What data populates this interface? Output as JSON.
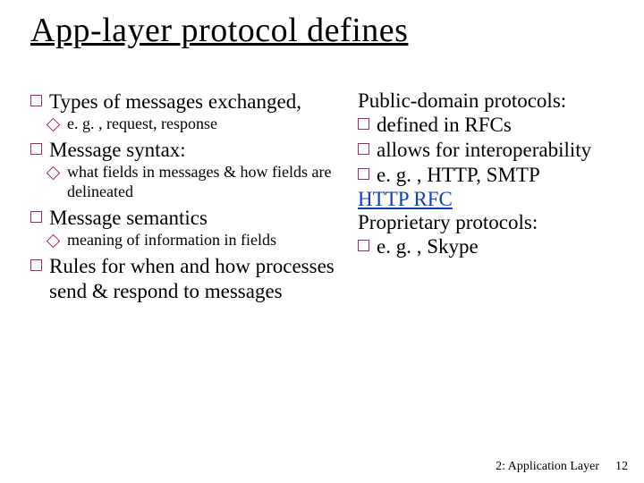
{
  "title": "App-layer protocol defines",
  "left": {
    "items": [
      {
        "text": "Types of messages exchanged,"
      },
      {
        "text": "Message syntax:"
      },
      {
        "text": "Message semantics"
      },
      {
        "text": "Rules for when and how processes send & respond to messages"
      }
    ],
    "subs": {
      "0": "e. g. , request, response",
      "1": "what fields in messages & how fields are delineated",
      "2": "meaning of information in fields"
    }
  },
  "right": {
    "heading1": "Public-domain protocols:",
    "items1": [
      "defined in RFCs",
      "allows for interoperability",
      "e. g. , HTTP, SMTP"
    ],
    "link": "HTTP RFC",
    "heading2": "Proprietary protocols:",
    "items2": [
      "e. g. , Skype"
    ]
  },
  "footer": {
    "chapter": "2: Application Layer",
    "page": "12"
  }
}
